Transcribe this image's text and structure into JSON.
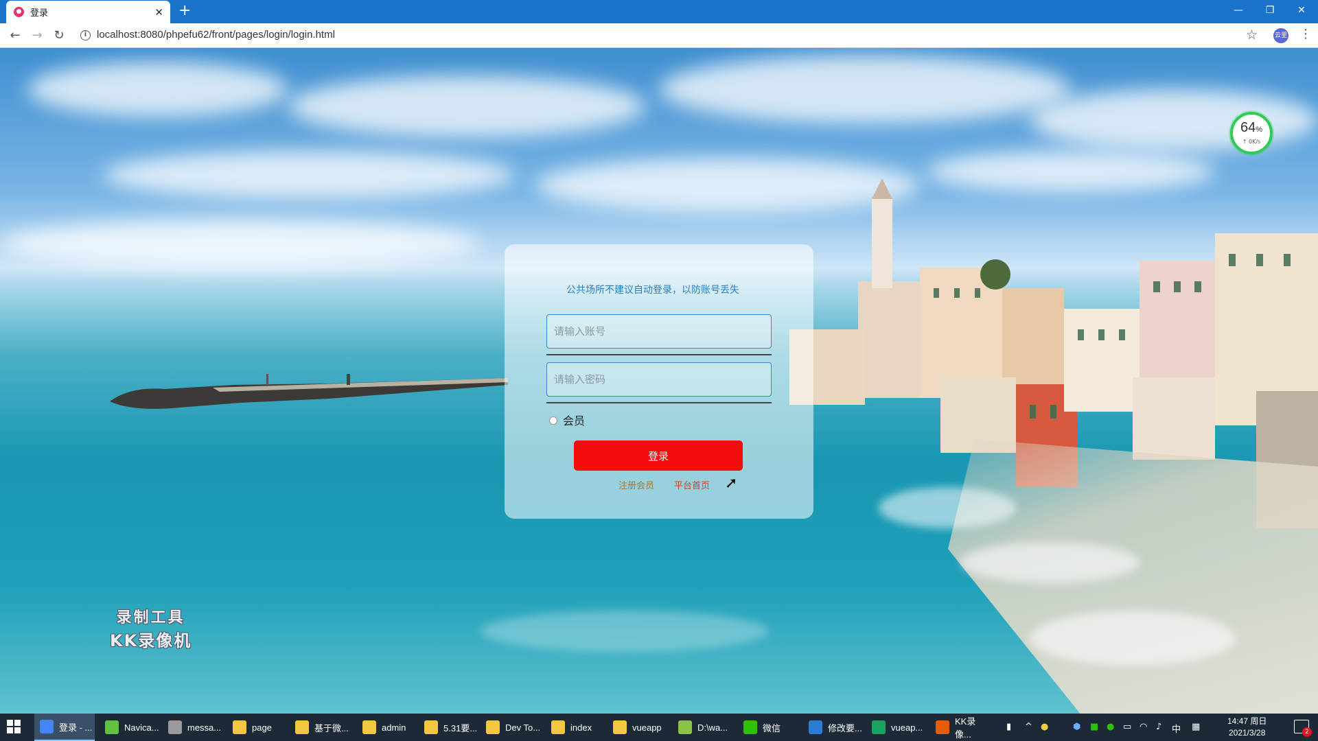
{
  "browser": {
    "tab_title": "登录",
    "url": "localhost:8080/phpefu62/front/pages/login/login.html",
    "profile_label": "云里"
  },
  "speed_widget": {
    "percent": "64",
    "percent_sign": "%",
    "rate": "↑ 0K/s"
  },
  "login": {
    "tip": "公共场所不建议自动登录，以防账号丢失",
    "username_placeholder": "请输入账号",
    "password_placeholder": "请输入密码",
    "role_label": "会员",
    "submit_label": "登录",
    "register_link": "注册会员",
    "home_link": "平台首页"
  },
  "watermark": {
    "line1": "录制工具",
    "line2": "KK录像机"
  },
  "taskbar": {
    "items": [
      {
        "label": "登录 - ...",
        "color": "#4285f4",
        "active": true
      },
      {
        "label": "Navica...",
        "color": "#62c341"
      },
      {
        "label": "messa...",
        "color": "#9a9a9a"
      },
      {
        "label": "page",
        "color": "#f5c842"
      },
      {
        "label": "基于微...",
        "color": "#f5c842"
      },
      {
        "label": "admin",
        "color": "#f5c842"
      },
      {
        "label": "5.31要...",
        "color": "#f5c842"
      },
      {
        "label": "Dev To...",
        "color": "#f5c842"
      },
      {
        "label": "index",
        "color": "#f5c842"
      },
      {
        "label": "vueapp",
        "color": "#f5c842"
      },
      {
        "label": "D:\\wa...",
        "color": "#8bc34a"
      },
      {
        "label": "微信",
        "color": "#2dc100"
      },
      {
        "label": "修改要...",
        "color": "#2b7cd3"
      },
      {
        "label": "vueap...",
        "color": "#1aa260"
      },
      {
        "label": "KK录像...",
        "color": "#e85d04"
      }
    ],
    "ime_label": "中",
    "time": "14:47 周日",
    "date": "2021/3/28",
    "notification_count": "2"
  }
}
